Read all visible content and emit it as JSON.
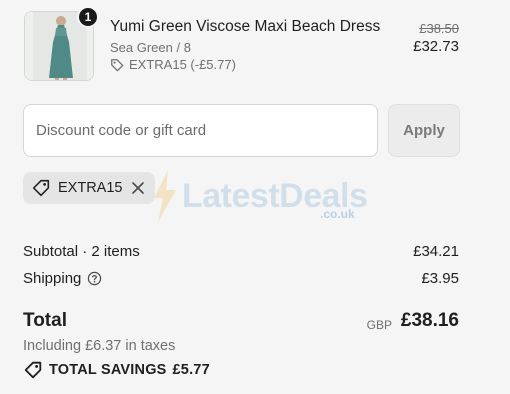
{
  "product": {
    "quantity": "1",
    "title": "Yumi Green Viscose Maxi Beach Dress",
    "variant": "Sea Green / 8",
    "discount_line": "EXTRA15 (-£5.77)",
    "original_price": "£38.50",
    "price": "£32.73",
    "image_icon": "dress-product-image"
  },
  "discount": {
    "placeholder": "Discount code or gift card",
    "value": "",
    "apply_label": "Apply",
    "applied_code": "EXTRA15"
  },
  "watermark": {
    "brand": "LatestDeals",
    "domain": ".co.uk"
  },
  "summary": {
    "subtotal_label": "Subtotal · 2 items",
    "subtotal_value": "£34.21",
    "shipping_label": "Shipping",
    "shipping_value": "£3.95",
    "total_label": "Total",
    "currency": "GBP",
    "total_value": "£38.16",
    "taxes_note": "Including £6.37 in taxes",
    "savings_label": "TOTAL SAVINGS",
    "savings_value": "£5.77"
  },
  "colors": {
    "background": "#f5f5f5",
    "text": "#1f1f1f",
    "muted": "#707070",
    "chip": "#e5e5e5"
  }
}
